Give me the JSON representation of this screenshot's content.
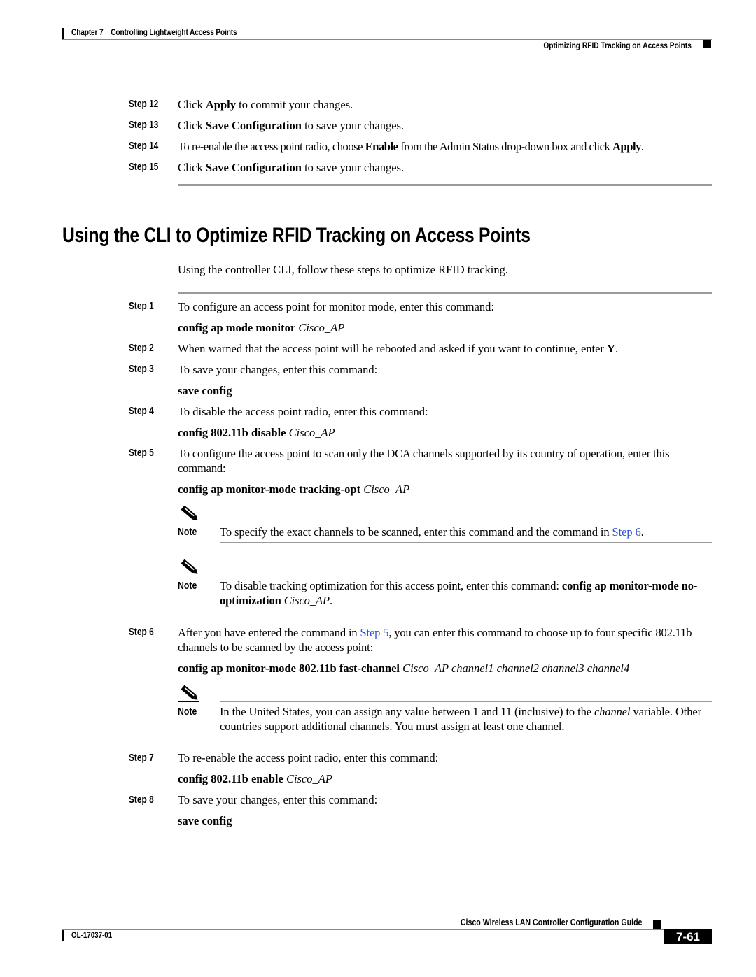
{
  "header": {
    "chapter_label": "Chapter 7",
    "chapter_title": "Controlling Lightweight Access Points",
    "section_title": "Optimizing RFID Tracking on Access Points"
  },
  "prior_steps": [
    {
      "label": "Step 12",
      "pre": "Click ",
      "bold": "Apply",
      "post": " to commit your changes."
    },
    {
      "label": "Step 13",
      "pre": "Click ",
      "bold": "Save Configuration",
      "post": " to save your changes."
    },
    {
      "label": "Step 14",
      "pre": "To re-enable the access point radio, choose ",
      "bold": "Enable",
      "mid": " from the Admin Status drop-down box and click ",
      "bold2": "Apply",
      "post": "."
    },
    {
      "label": "Step 15",
      "pre": "Click ",
      "bold": "Save Configuration",
      "post": " to save your changes."
    }
  ],
  "section": {
    "heading": "Using the CLI to Optimize RFID Tracking on Access Points",
    "intro": "Using the controller CLI, follow these steps to optimize RFID tracking."
  },
  "steps": [
    {
      "label": "Step 1",
      "text": "To configure an access point for monitor mode, enter this command:",
      "cmd_bold": "config ap mode monitor",
      "cmd_italic": "Cisco_AP"
    },
    {
      "label": "Step 2",
      "text": "When warned that the access point will be rebooted and asked if you want to continue, enter ",
      "text_bold": "Y",
      "text_end": "."
    },
    {
      "label": "Step 3",
      "text": "To save your changes, enter this command:",
      "cmd_bold": "save config"
    },
    {
      "label": "Step 4",
      "text": "To disable the access point radio, enter this command:",
      "cmd_bold": "config 802.11b disable",
      "cmd_italic": "Cisco_AP"
    },
    {
      "label": "Step 5",
      "text": "To configure the access point to scan only the DCA channels supported by its country of operation, enter this command:",
      "cmd_bold": "config ap monitor-mode tracking-opt",
      "cmd_italic": "Cisco_AP"
    },
    {
      "label": "Step 6",
      "text_pre": "After you have entered the command in ",
      "link": "Step 5",
      "text_post": ", you can enter this command to choose up to four specific 802.11b channels to be scanned by the access point:",
      "cmd_bold": "config ap monitor-mode 802.11b fast-channel",
      "cmd_italic": "Cisco_AP channel1 channel2 channel3 channel4"
    },
    {
      "label": "Step 7",
      "text": "To re-enable the access point radio, enter this command:",
      "cmd_bold": "config 802.11b enable",
      "cmd_italic": "Cisco_AP"
    },
    {
      "label": "Step 8",
      "text": "To save your changes, enter this command:",
      "cmd_bold": "save config"
    }
  ],
  "notes": [
    {
      "label": "Note",
      "pre": "To specify the exact channels to be scanned, enter this command and the command in ",
      "link": "Step 6",
      "post": "."
    },
    {
      "label": "Note",
      "pre": "To disable tracking optimization for this access point, enter this command: ",
      "bold": "config ap monitor-mode no-optimization",
      "italic": "Cisco_AP",
      "post": "."
    },
    {
      "label": "Note",
      "pre": "In the United States, you can assign any value between 1 and 11 (inclusive) to the ",
      "italic": "channel",
      "post": " variable. Other countries support additional channels. You must assign at least one channel."
    }
  ],
  "footer": {
    "guide_title": "Cisco Wireless LAN Controller Configuration Guide",
    "doc_number": "OL-17037-01",
    "page_number": "7-61"
  },
  "colors": {
    "link": "#2a4fd6",
    "rule": "#9a9a9a"
  }
}
